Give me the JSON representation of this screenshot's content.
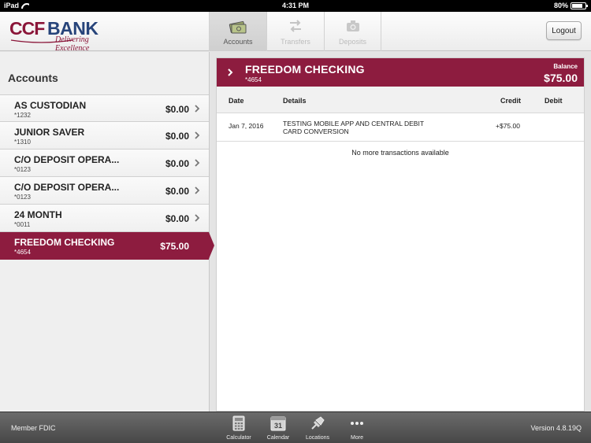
{
  "status_bar": {
    "device": "iPad",
    "time": "4:31 PM",
    "battery": "80%",
    "battery_level": 0.8
  },
  "header": {
    "logo": {
      "ccf": "CCF",
      "bank": "BANK",
      "tagline": "Delivering Excellence"
    },
    "tabs": [
      {
        "label": "Accounts",
        "icon": "money-icon",
        "active": true
      },
      {
        "label": "Transfers",
        "icon": "transfer-arrows-icon",
        "active": false
      },
      {
        "label": "Deposits",
        "icon": "camera-icon",
        "active": false
      }
    ],
    "logout_label": "Logout"
  },
  "sidebar": {
    "title": "Accounts",
    "accounts": [
      {
        "name": "AS CUSTODIAN",
        "number": "*1232",
        "balance": "$0.00"
      },
      {
        "name": "JUNIOR SAVER",
        "number": "*1310",
        "balance": "$0.00"
      },
      {
        "name": "C/O DEPOSIT OPERA...",
        "number": "*0123",
        "balance": "$0.00"
      },
      {
        "name": "C/O DEPOSIT OPERA...",
        "number": "*0123",
        "balance": "$0.00"
      },
      {
        "name": "24 MONTH",
        "number": "*0011",
        "balance": "$0.00"
      },
      {
        "name": "FREEDOM CHECKING",
        "number": "*4654",
        "balance": "$75.00",
        "selected": true
      }
    ]
  },
  "main": {
    "account_title": "FREEDOM CHECKING",
    "account_number": "*4654",
    "balance_label": "Balance",
    "balance": "$75.00",
    "columns": {
      "date": "Date",
      "details": "Details",
      "credit": "Credit",
      "debit": "Debit"
    },
    "transactions": [
      {
        "date": "Jan 7, 2016",
        "details_line1": "TESTING MOBILE APP AND CENTRAL DEBIT",
        "details_line2": "CARD CONVERSION",
        "credit": "+$75.00",
        "debit": ""
      }
    ],
    "no_more": "No more transactions available"
  },
  "footer": {
    "member": "Member FDIC",
    "version": "Version 4.8.19Q",
    "tools": [
      {
        "label": "Calculator",
        "icon": "calculator-icon"
      },
      {
        "label": "Calendar",
        "icon": "calendar-icon",
        "day": "31"
      },
      {
        "label": "Locations",
        "icon": "location-pin-icon"
      },
      {
        "label": "More",
        "icon": "more-dots-icon"
      }
    ]
  },
  "colors": {
    "brand_maroon": "#8d1c3f",
    "brand_navy": "#27447a"
  }
}
